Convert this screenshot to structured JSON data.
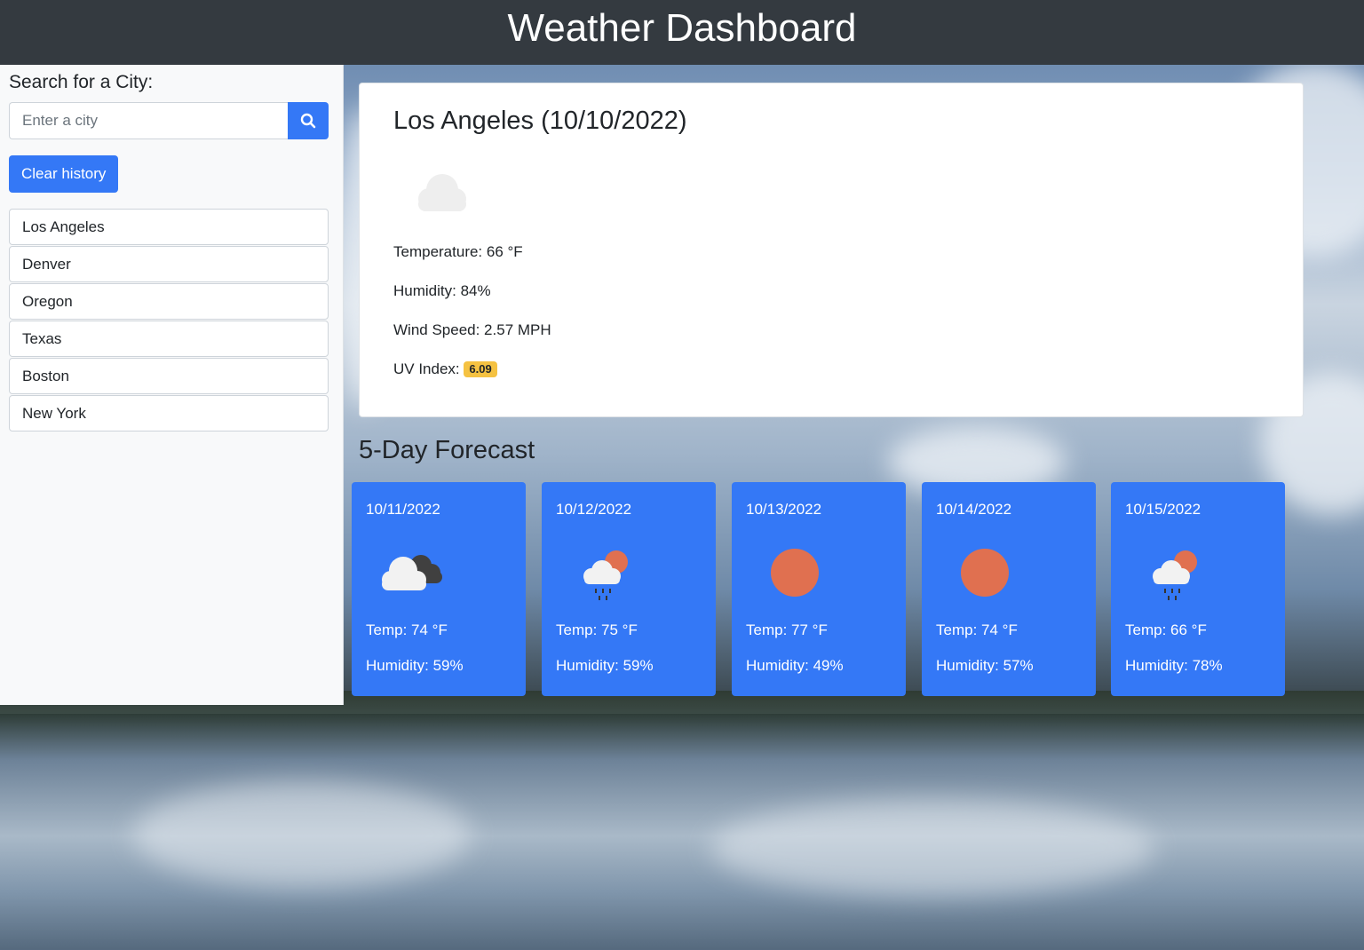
{
  "header": {
    "title": "Weather Dashboard"
  },
  "sidebar": {
    "search_heading": "Search for a City:",
    "search_placeholder": "Enter a city",
    "search_button_icon": "search-icon",
    "clear_label": "Clear history",
    "history": [
      {
        "label": "Los Angeles"
      },
      {
        "label": "Denver"
      },
      {
        "label": "Oregon"
      },
      {
        "label": "Texas"
      },
      {
        "label": "Boston"
      },
      {
        "label": "New York"
      }
    ]
  },
  "current": {
    "title": "Los Angeles (10/10/2022)",
    "icon": "cloud-icon",
    "temperature": "Temperature: 66 °F",
    "humidity": "Humidity: 84%",
    "wind": "Wind Speed: 2.57 MPH",
    "uv_label": "UV Index: ",
    "uv_value": "6.09",
    "uv_color": "#f5c242"
  },
  "forecast": {
    "title": "5-Day Forecast",
    "days": [
      {
        "date": "10/11/2022",
        "icon": "broken-clouds-icon",
        "temp": "Temp: 74 °F",
        "humidity": "Humidity: 59%"
      },
      {
        "date": "10/12/2022",
        "icon": "rain-sun-icon",
        "temp": "Temp: 75 °F",
        "humidity": "Humidity: 59%"
      },
      {
        "date": "10/13/2022",
        "icon": "sun-icon",
        "temp": "Temp: 77 °F",
        "humidity": "Humidity: 49%"
      },
      {
        "date": "10/14/2022",
        "icon": "sun-icon",
        "temp": "Temp: 74 °F",
        "humidity": "Humidity: 57%"
      },
      {
        "date": "10/15/2022",
        "icon": "rain-sun-icon",
        "temp": "Temp: 66 °F",
        "humidity": "Humidity: 78%"
      }
    ]
  },
  "colors": {
    "header": "#343a40",
    "accent": "#3478f6",
    "sun": "#e07050"
  }
}
